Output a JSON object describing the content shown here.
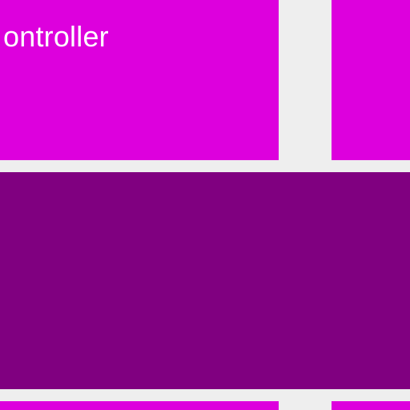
{
  "colors": {
    "background": "#eeeeee",
    "tile_light": "#dd00dd",
    "tile_dark": "#800080",
    "text": "#ffffff"
  },
  "tiles": {
    "controller_label": "ontroller"
  }
}
